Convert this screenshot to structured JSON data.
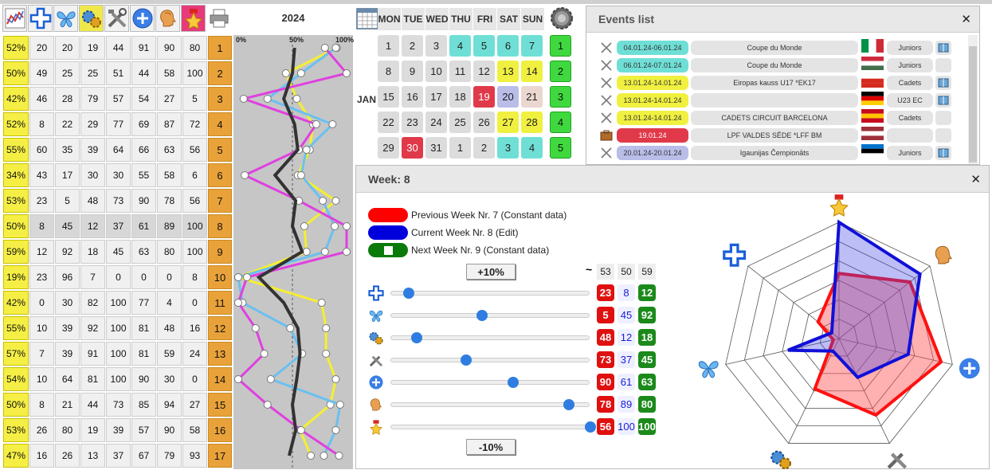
{
  "year": "2024",
  "toolbar": [
    "chart-icon",
    "cross-icon",
    "butterfly-icon",
    "gears-icon",
    "tools-icon",
    "plus-circle-icon",
    "head-icon",
    "star-icon",
    "printer-icon"
  ],
  "chart_ticks": [
    "0%",
    "50%",
    "100%"
  ],
  "weeks": [
    {
      "pct": "52%",
      "vals": [
        20,
        20,
        19,
        44,
        91,
        90,
        80
      ],
      "wk": "1"
    },
    {
      "pct": "50%",
      "vals": [
        49,
        25,
        25,
        51,
        44,
        58,
        100
      ],
      "wk": "2"
    },
    {
      "pct": "42%",
      "vals": [
        46,
        28,
        79,
        57,
        54,
        27,
        5
      ],
      "wk": "3"
    },
    {
      "pct": "52%",
      "vals": [
        8,
        22,
        29,
        77,
        69,
        87,
        72
      ],
      "wk": "4"
    },
    {
      "pct": "55%",
      "vals": [
        60,
        35,
        39,
        64,
        66,
        63,
        56
      ],
      "wk": "5"
    },
    {
      "pct": "34%",
      "vals": [
        43,
        17,
        30,
        30,
        55,
        58,
        6
      ],
      "wk": "6"
    },
    {
      "pct": "53%",
      "vals": [
        23,
        5,
        48,
        73,
        90,
        78,
        56
      ],
      "wk": "7"
    },
    {
      "pct": "50%",
      "vals": [
        8,
        45,
        12,
        37,
        61,
        89,
        100
      ],
      "wk": "8",
      "selected": true
    },
    {
      "pct": "59%",
      "vals": [
        12,
        92,
        18,
        45,
        63,
        80,
        100
      ],
      "wk": "9"
    },
    {
      "pct": "19%",
      "vals": [
        23,
        96,
        7,
        0,
        0,
        0,
        8
      ],
      "wk": "10"
    },
    {
      "pct": "42%",
      "vals": [
        0,
        30,
        82,
        100,
        77,
        4,
        0
      ],
      "wk": "11"
    },
    {
      "pct": "55%",
      "vals": [
        10,
        39,
        92,
        100,
        81,
        48,
        16
      ],
      "wk": "12"
    },
    {
      "pct": "57%",
      "vals": [
        7,
        39,
        91,
        100,
        81,
        59,
        24
      ],
      "wk": "13"
    },
    {
      "pct": "54%",
      "vals": [
        10,
        64,
        81,
        100,
        90,
        30,
        0
      ],
      "wk": "14"
    },
    {
      "pct": "50%",
      "vals": [
        8,
        21,
        44,
        73,
        85,
        94,
        27
      ],
      "wk": "15"
    },
    {
      "pct": "53%",
      "vals": [
        26,
        80,
        19,
        39,
        57,
        90,
        58
      ],
      "wk": "16"
    },
    {
      "pct": "47%",
      "vals": [
        16,
        26,
        13,
        37,
        67,
        79,
        93
      ],
      "wk": "17"
    }
  ],
  "calendar": {
    "days": [
      "MON",
      "TUE",
      "WED",
      "THU",
      "FRI",
      "SAT",
      "SUN"
    ],
    "month": "JAN",
    "rows": [
      {
        "cells": [
          [
            "1",
            ""
          ],
          [
            "2",
            ""
          ],
          [
            "3",
            ""
          ],
          [
            "4",
            "cyan"
          ],
          [
            "5",
            "cyan"
          ],
          [
            "6",
            "cyan"
          ],
          [
            "7",
            "cyan"
          ]
        ],
        "wk": "1"
      },
      {
        "cells": [
          [
            "8",
            ""
          ],
          [
            "9",
            ""
          ],
          [
            "10",
            ""
          ],
          [
            "11",
            ""
          ],
          [
            "12",
            ""
          ],
          [
            "13",
            "yel"
          ],
          [
            "14",
            "yel"
          ]
        ],
        "wk": "2"
      },
      {
        "cells": [
          [
            "15",
            ""
          ],
          [
            "16",
            ""
          ],
          [
            "17",
            ""
          ],
          [
            "18",
            ""
          ],
          [
            "19",
            "red"
          ],
          [
            "20",
            "lav"
          ],
          [
            "21",
            "pink"
          ]
        ],
        "wk": "3"
      },
      {
        "cells": [
          [
            "22",
            ""
          ],
          [
            "23",
            ""
          ],
          [
            "24",
            ""
          ],
          [
            "25",
            ""
          ],
          [
            "26",
            ""
          ],
          [
            "27",
            "yel"
          ],
          [
            "28",
            "yel"
          ]
        ],
        "wk": "4"
      },
      {
        "cells": [
          [
            "29",
            ""
          ],
          [
            "30",
            "red"
          ],
          [
            "31",
            ""
          ],
          [
            "1",
            ""
          ],
          [
            "2",
            ""
          ],
          [
            "3",
            "cyan"
          ],
          [
            "4",
            "cyan"
          ]
        ],
        "wk": "5"
      }
    ]
  },
  "events": {
    "title": "Events list",
    "items": [
      {
        "icon": "fencing-icon",
        "date": "04.01.24-06.01.24",
        "dcolor": "#6fdfd6",
        "name": "Coupe du Monde",
        "flag": [
          "#009246",
          "#ffffff",
          "#ce2b37"
        ],
        "fdir": "v",
        "cat": "Juniors",
        "book": true
      },
      {
        "icon": "fencing-icon",
        "date": "06.01.24-07.01.24",
        "dcolor": "#6fdfd6",
        "name": "Coupe du Monde",
        "flag": [
          "#cd2a3e",
          "#ffffff",
          "#436f4d"
        ],
        "fdir": "h",
        "cat": "Juniors",
        "book": false
      },
      {
        "icon": "fencing-icon",
        "date": "13.01.24-14.01.24",
        "dcolor": "#f0f040",
        "name": "Eiropas kauss U17 *EK17",
        "flag": [
          "#ffffff",
          "#d52b1e",
          "#d52b1e"
        ],
        "fdir": "h",
        "cat": "Cadets",
        "book": true
      },
      {
        "icon": "fencing-icon",
        "date": "13.01.24-14.01.24",
        "dcolor": "#f0f040",
        "name": "",
        "flag": [
          "#000000",
          "#dd0000",
          "#ffce00"
        ],
        "fdir": "h",
        "cat": "U23 EC",
        "book": true
      },
      {
        "icon": "fencing-icon",
        "date": "13.01.24-14.01.24",
        "dcolor": "#f0f040",
        "name": "CADETS CIRCUIT BARCELONA",
        "flag": [
          "#c60b1e",
          "#ffc400",
          "#c60b1e"
        ],
        "fdir": "h",
        "cat": "Cadets",
        "book": false
      },
      {
        "icon": "briefcase-icon",
        "date": "19.01.24",
        "dcolor": "#e03a4a",
        "name": "LPF VALDES SĒDE *LFF BM",
        "flag": [
          "#9e3039",
          "#ffffff",
          "#9e3039"
        ],
        "fdir": "h",
        "cat": "",
        "book": false
      },
      {
        "icon": "fencing-icon",
        "date": "20.01.24-20.01.24",
        "dcolor": "#b9bde8",
        "name": "Igaunijas Čempionāts",
        "flag": [
          "#0072ce",
          "#000000",
          "#ffffff"
        ],
        "fdir": "h",
        "cat": "Juniors",
        "book": true
      }
    ]
  },
  "week_panel": {
    "title": "Week: 8",
    "legend": [
      {
        "label": "Previous Week Nr. 7  (Constant data)",
        "color": "#ff0000"
      },
      {
        "label": "Current Week Nr. 8 (Edit)",
        "color": "#0000dd"
      },
      {
        "label": "Next Week Nr. 9 (Constant data)",
        "color": "#0a7a0a"
      }
    ],
    "plus_label": "+10%",
    "minus_label": "-10%",
    "tilde": "~",
    "col_totals": [
      "53",
      "50",
      "59"
    ],
    "rows": [
      {
        "icon": "cross-icon",
        "prev": "23",
        "cur": "8",
        "next": "12",
        "slider": 8
      },
      {
        "icon": "butterfly-icon",
        "prev": "5",
        "cur": "45",
        "next": "92",
        "slider": 45
      },
      {
        "icon": "gears-icon",
        "prev": "48",
        "cur": "12",
        "next": "18",
        "slider": 12
      },
      {
        "icon": "tools-icon",
        "prev": "73",
        "cur": "37",
        "next": "45",
        "slider": 37
      },
      {
        "icon": "plus-circle-icon",
        "prev": "90",
        "cur": "61",
        "next": "63",
        "slider": 61
      },
      {
        "icon": "head-icon",
        "prev": "78",
        "cur": "89",
        "next": "80",
        "slider": 89
      },
      {
        "icon": "star-icon",
        "prev": "56",
        "cur": "100",
        "next": "100",
        "slider": 100
      }
    ]
  },
  "chart_data": {
    "type": "radar",
    "axes": [
      "star",
      "head",
      "plus-circle",
      "tools",
      "gears",
      "butterfly",
      "cross"
    ],
    "series": [
      {
        "name": "Previous Week Nr. 7  (Constant data)",
        "values": [
          56,
          78,
          90,
          73,
          48,
          5,
          23
        ]
      },
      {
        "name": "Current Week Nr. 8 (Edit)",
        "values": [
          100,
          89,
          61,
          37,
          12,
          45,
          8
        ]
      }
    ],
    "rmax": 100
  }
}
